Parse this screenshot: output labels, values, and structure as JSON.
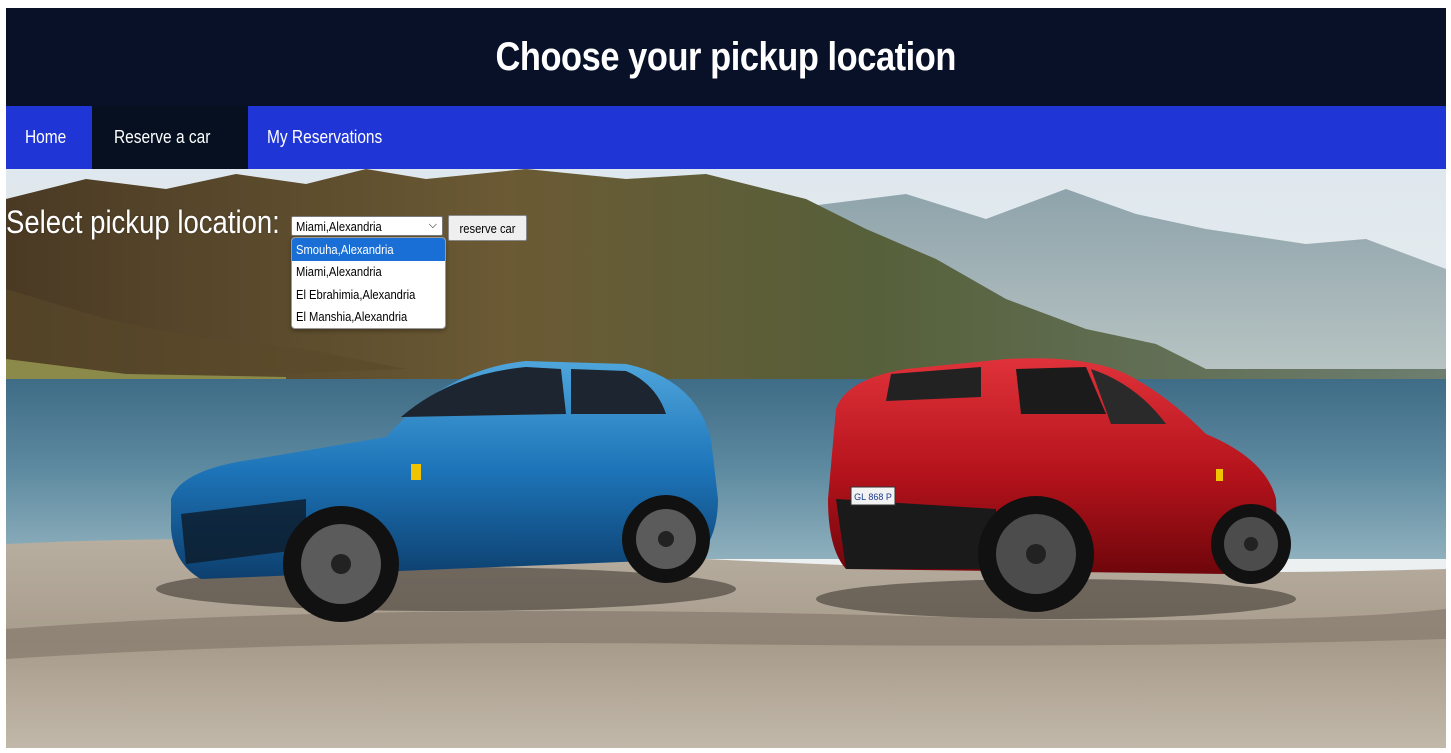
{
  "header": {
    "title": "Choose your pickup location"
  },
  "nav": {
    "items": [
      {
        "label": "Home",
        "active": false
      },
      {
        "label": "Reserve a car",
        "active": true
      },
      {
        "label": "My Reservations",
        "active": false
      }
    ]
  },
  "picker": {
    "label": "Select pickup location:",
    "selected": "Miami,Alexandria",
    "button_label": "reserve car",
    "options": [
      "Smouha,Alexandria",
      "Miami,Alexandria",
      "El Ebrahimia,Alexandria",
      "El Manshia,Alexandria"
    ],
    "highlighted_index": 0
  },
  "hero": {
    "description_icon": "car-landscape-image",
    "left_car_plate": "",
    "right_car_plate": "GL 868 P"
  },
  "colors": {
    "header_bg": "#081128",
    "nav_bg": "#1f35d6",
    "nav_active_bg": "#061021",
    "option_highlight": "#1a6fd6"
  }
}
